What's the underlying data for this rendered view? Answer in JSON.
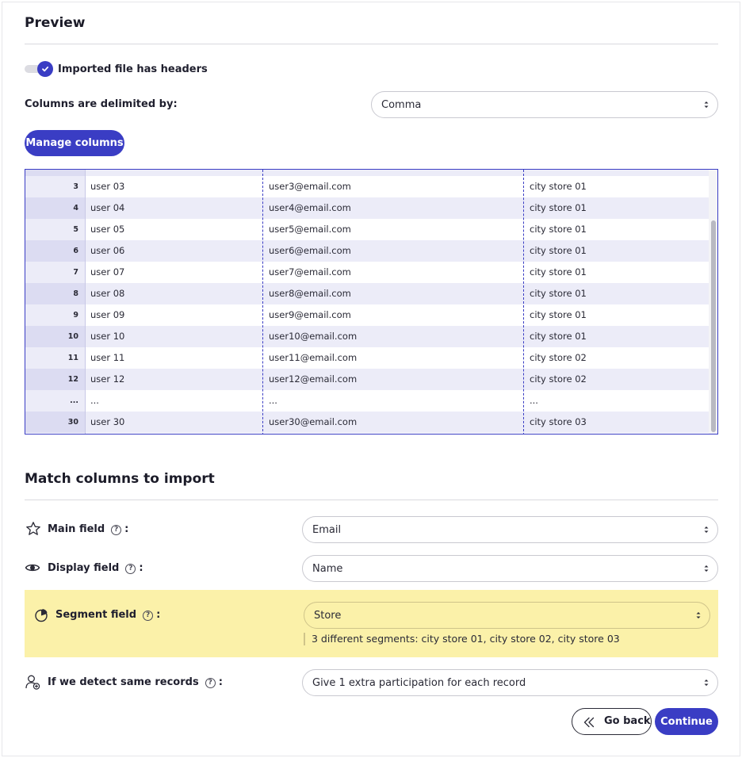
{
  "preview": {
    "title": "Preview",
    "headers_toggle_label": "Imported file has headers",
    "delimiter_label": "Columns are delimited by:",
    "delimiter_value": "Comma",
    "manage_columns_label": "Manage columns"
  },
  "table": {
    "rows": [
      {
        "num": "3",
        "name": "user 03",
        "email": "user3@email.com",
        "store": "city store 01"
      },
      {
        "num": "4",
        "name": "user 04",
        "email": "user4@email.com",
        "store": "city store 01"
      },
      {
        "num": "5",
        "name": "user 05",
        "email": "user5@email.com",
        "store": "city store 01"
      },
      {
        "num": "6",
        "name": "user 06",
        "email": "user6@email.com",
        "store": "city store 01"
      },
      {
        "num": "7",
        "name": "user 07",
        "email": "user7@email.com",
        "store": "city store 01"
      },
      {
        "num": "8",
        "name": "user 08",
        "email": "user8@email.com",
        "store": "city store 01"
      },
      {
        "num": "9",
        "name": "user 09",
        "email": "user9@email.com",
        "store": "city store 01"
      },
      {
        "num": "10",
        "name": "user 10",
        "email": "user10@email.com",
        "store": "city store 01"
      },
      {
        "num": "11",
        "name": "user 11",
        "email": "user11@email.com",
        "store": "city store 02"
      },
      {
        "num": "12",
        "name": "user 12",
        "email": "user12@email.com",
        "store": "city store 02"
      },
      {
        "num": "...",
        "name": "...",
        "email": "...",
        "store": "..."
      },
      {
        "num": "30",
        "name": "user 30",
        "email": "user30@email.com",
        "store": "city store 03"
      }
    ]
  },
  "match": {
    "title": "Match columns to import",
    "main_field_label": "Main field",
    "main_field_value": "Email",
    "display_field_label": "Display field",
    "display_field_value": "Name",
    "segment_field_label": "Segment field",
    "segment_field_value": "Store",
    "segment_hint": "3 different segments: city store 01, city store 02, city store 03",
    "same_records_label": "If we detect same records",
    "same_records_value": "Give 1 extra participation for each record",
    "help_glyph": "?",
    "colon": ":"
  },
  "actions": {
    "go_back_label": "Go back",
    "continue_label": "Continue"
  },
  "colors": {
    "accent": "#3a3dc4",
    "segment_highlight": "#fbf1a9"
  },
  "icons": {
    "toggle_check": "check-icon",
    "main_field": "star-icon",
    "display_field": "eye-icon",
    "segment_field": "pie-chart-icon",
    "same_records": "user-plus-icon",
    "help": "question-circle-icon",
    "select_arrows": "up-down-arrows-icon",
    "go_back": "double-chevron-left-icon"
  }
}
